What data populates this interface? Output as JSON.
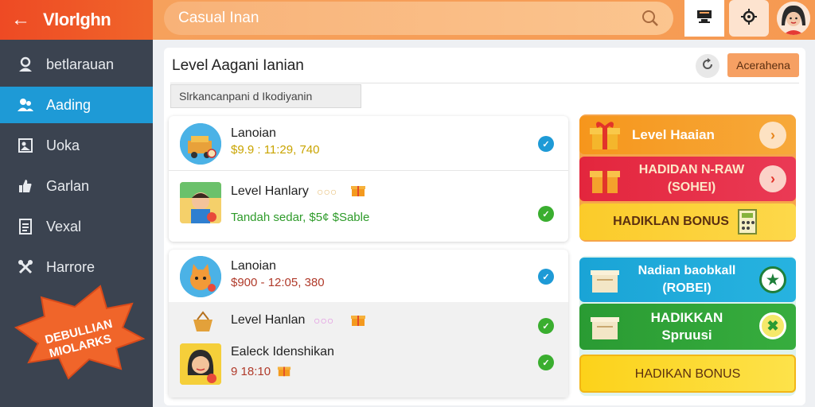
{
  "app": {
    "title": "Vlorlghn"
  },
  "search": {
    "placeholder": "Casual Inan"
  },
  "sidebar": {
    "items": [
      {
        "label": "betlarauan"
      },
      {
        "label": "Aading"
      },
      {
        "label": "Uoka"
      },
      {
        "label": "Garlan"
      },
      {
        "label": "Vexal"
      },
      {
        "label": "Harrore"
      }
    ],
    "burst_badge": {
      "line1": "DEBULLIAN",
      "line2": "MIOLARKS"
    }
  },
  "panel": {
    "title": "Level Aagani Ianian",
    "action": "Acerahena",
    "subsearch": "Slrkancanpani d Ikodiyanin"
  },
  "list1": [
    {
      "title": "Lanoian",
      "sub": "$9.9 : 11:29, 740"
    },
    {
      "title": "Level Hanlary",
      "sub": "Tandah sedar, $5¢ $Sable"
    }
  ],
  "list2": [
    {
      "title": "Lanoian",
      "sub": "$900 - 12:05, 380"
    },
    {
      "title": "Level Hanlan"
    },
    {
      "title": "Ealeck Idenshikan",
      "sub": "9 18:10"
    }
  ],
  "promos1": [
    {
      "label": "Level Haaian"
    },
    {
      "line1": "HADIDAN N-RAW",
      "line2": "(SOHEI)"
    },
    {
      "label": "HADIKLAN BONUS"
    }
  ],
  "promos2": [
    {
      "line1": "Nadian baobkall",
      "line2": "(ROBEI)"
    },
    {
      "line1": "HADIKKAN",
      "line2": "Spruusi"
    },
    {
      "label": "HADIKAN BONUS"
    }
  ],
  "colors": {
    "accent_orange": "#f0652a",
    "sidebar_bg": "#3b4350",
    "active_blue": "#1e9ad6",
    "promo_red": "#e52c47",
    "promo_green": "#34a83b",
    "promo_yellow": "#fbd02a"
  }
}
